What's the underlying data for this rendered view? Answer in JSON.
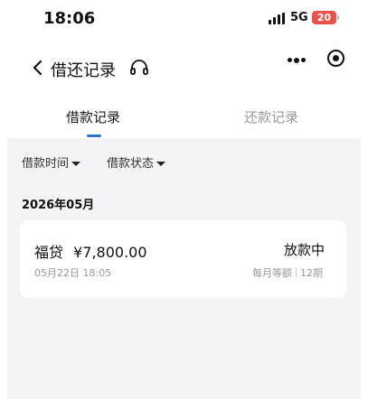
{
  "status_bar": {
    "time": "18:06",
    "network": "5G",
    "battery": "20"
  },
  "header": {
    "title": "借还记录"
  },
  "tabs": [
    {
      "label": "借款记录",
      "active": true
    },
    {
      "label": "还款记录",
      "active": false
    }
  ],
  "filters": {
    "time_label": "借款时间",
    "status_label": "借款状态"
  },
  "month": "2026年05月",
  "loans": [
    {
      "product": "福贷",
      "amount": "¥7,800.00",
      "date": "05月22日 18:05",
      "status": "放款中",
      "repayment_method": "每月等额",
      "term": "12期"
    }
  ],
  "colors": {
    "accent": "#2f74c9",
    "battery": "#e8524a",
    "background": "#f4f4f6"
  }
}
